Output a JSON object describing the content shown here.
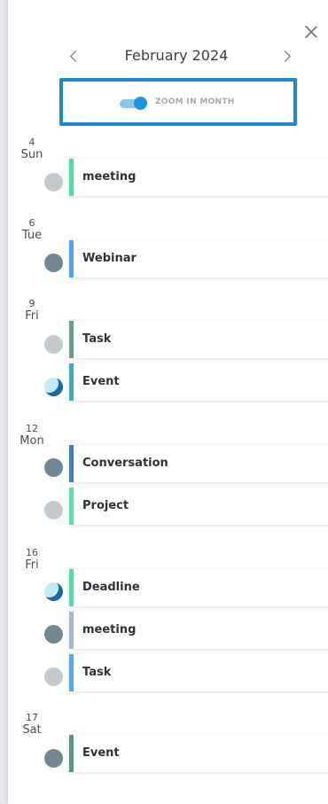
{
  "header": {
    "month_label": "February 2024",
    "zoom_toggle_label": "ZOOM IN MONTH",
    "zoom_enabled": true,
    "prev_icon": "chevron-left-icon",
    "next_icon": "chevron-right-icon",
    "close_icon": "close-icon"
  },
  "days": [
    {
      "num": "4",
      "name": "Sun"
    },
    {
      "num": "6",
      "name": "Tue"
    },
    {
      "num": "9",
      "name": "Fri"
    },
    {
      "num": "12",
      "name": "Mon"
    },
    {
      "num": "16",
      "name": "Fri"
    },
    {
      "num": "17",
      "name": "Sat"
    }
  ],
  "events": [
    {
      "title": "meeting",
      "color": "#5fd6a6",
      "dot": "light"
    },
    {
      "title": "Webinar",
      "color": "#5b9cf3",
      "dot": "dark"
    },
    {
      "title": "Task",
      "color": "#6d9a8a",
      "dot": "light"
    },
    {
      "title": "Event",
      "color": "#4aa6b8",
      "dot": "cyan"
    },
    {
      "title": "Conversation",
      "color": "#4a78b8",
      "dot": "dark"
    },
    {
      "title": "Project",
      "color": "#67d8b0",
      "dot": "light"
    },
    {
      "title": "Deadline",
      "color": "#5fd6a6",
      "dot": "cyan"
    },
    {
      "title": "meeting",
      "color": "#a8b6d6",
      "dot": "dark"
    },
    {
      "title": "Task",
      "color": "#62a2f2",
      "dot": "light"
    },
    {
      "title": "Event",
      "color": "#5e9482",
      "dot": "dark"
    }
  ]
}
